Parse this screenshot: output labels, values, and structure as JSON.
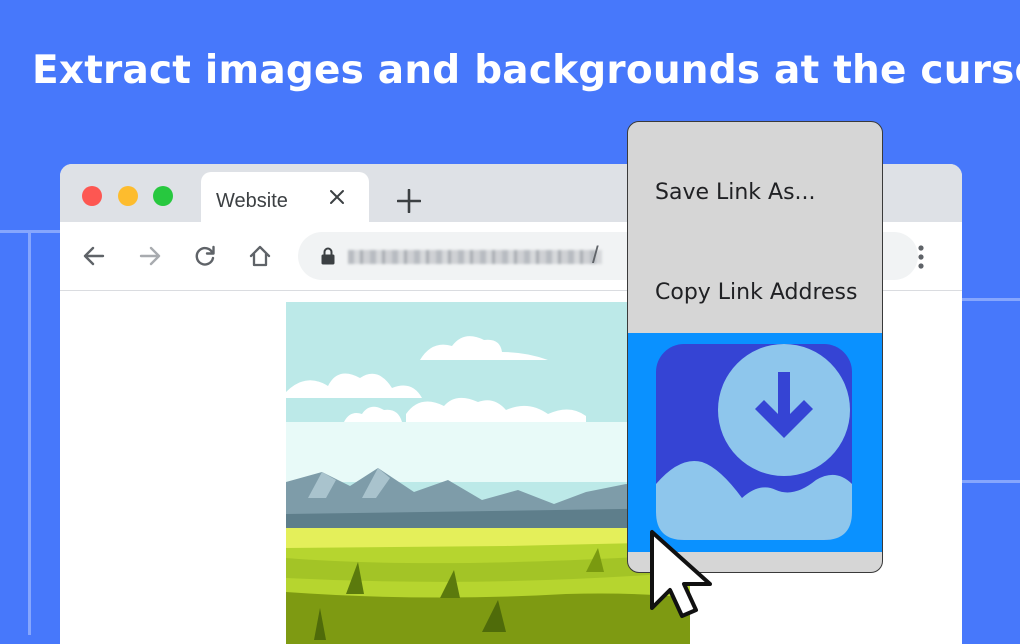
{
  "headline": "Extract images and backgrounds at the cursor",
  "colors": {
    "background": "#4778fb",
    "titlebar": "#dee1e6",
    "menu": "#d6d6d6",
    "extension_highlight": "#0a91ff",
    "extension_icon_bg": "#3544d4",
    "extension_icon_fg": "#8ec6ec"
  },
  "browser": {
    "window_controls": [
      "close-dot",
      "minimize-dot",
      "maximize-dot"
    ],
    "tab": {
      "title": "Website",
      "close_icon": "close-icon"
    },
    "new_tab_icon": "plus-icon",
    "toolbar": {
      "icons": [
        "back-arrow-icon",
        "forward-arrow-icon",
        "reload-icon",
        "home-icon"
      ],
      "address": {
        "lock_icon": "lock-icon",
        "url_suffix": "/",
        "url_obscured": "blurred-url"
      },
      "menu_icon": "kebab-menu-icon"
    }
  },
  "context_menu": {
    "items": [
      {
        "label": "Save Link As..."
      },
      {
        "label": "Copy Link Address"
      }
    ],
    "extension_item_icon": "image-download-icon"
  },
  "cursor_icon": "arrow-cursor-icon"
}
